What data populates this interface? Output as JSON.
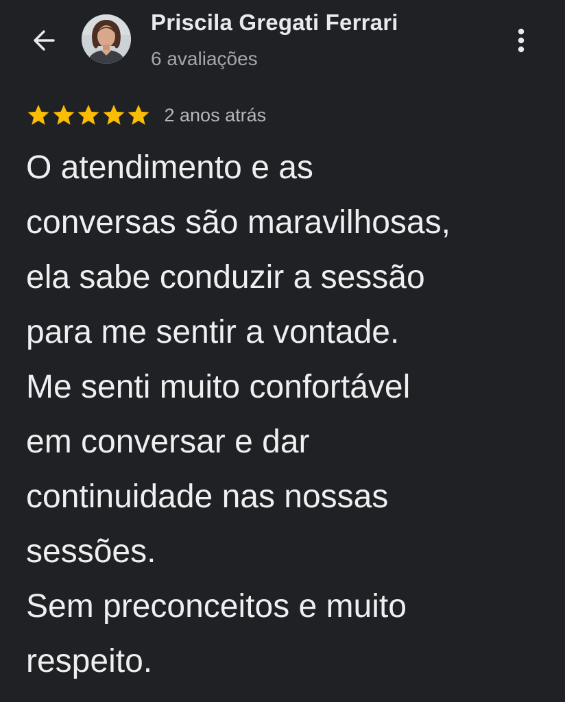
{
  "header": {
    "back_icon": "arrow-left-icon",
    "avatar_icon": "user-avatar",
    "author_name": "Priscila Gregati Ferrari",
    "review_count": "6 avaliações",
    "more_icon": "more-vert-icon"
  },
  "review": {
    "rating": 5,
    "rating_max": 5,
    "star_color": "#fbbc04",
    "time_ago": "2 anos atrás",
    "text": "O atendimento e as\nconversas são maravilhosas,\nela sabe conduzir a sessão\npara me sentir a vontade.\nMe senti muito confortável\nem conversar e dar\ncontinuidade nas nossas\nsessões.\nSem preconceitos e muito\nrespeito."
  },
  "colors": {
    "background": "#202124",
    "text_primary": "#e8eaed",
    "text_secondary": "#a3a7ac"
  }
}
